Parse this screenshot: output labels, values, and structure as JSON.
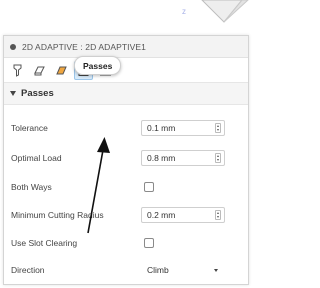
{
  "panel": {
    "title": "2D ADAPTIVE : 2D ADAPTIVE1",
    "toolbar_icons": [
      "tool-icon",
      "geometry-icon",
      "heights-icon",
      "passes-icon",
      "linking-icon"
    ],
    "active_tool_index": 3
  },
  "section": {
    "title": "Passes",
    "tooltip": "Passes"
  },
  "fields": {
    "tolerance": {
      "label": "Tolerance",
      "value": "0.1 mm"
    },
    "optimal_load": {
      "label": "Optimal Load",
      "value": "0.8 mm"
    },
    "both_ways": {
      "label": "Both Ways",
      "checked": false
    },
    "min_cutting_radius": {
      "label": "Minimum Cutting Radius",
      "value": "0.2 mm"
    },
    "slot_clearing": {
      "label": "Use Slot Clearing",
      "checked": false
    },
    "direction": {
      "label": "Direction",
      "value": "Climb"
    }
  },
  "colors": {
    "active_tool_bg": "#d9ecfb",
    "active_tool_border": "#9cc6ea",
    "panel_border": "#d4d4d4"
  }
}
